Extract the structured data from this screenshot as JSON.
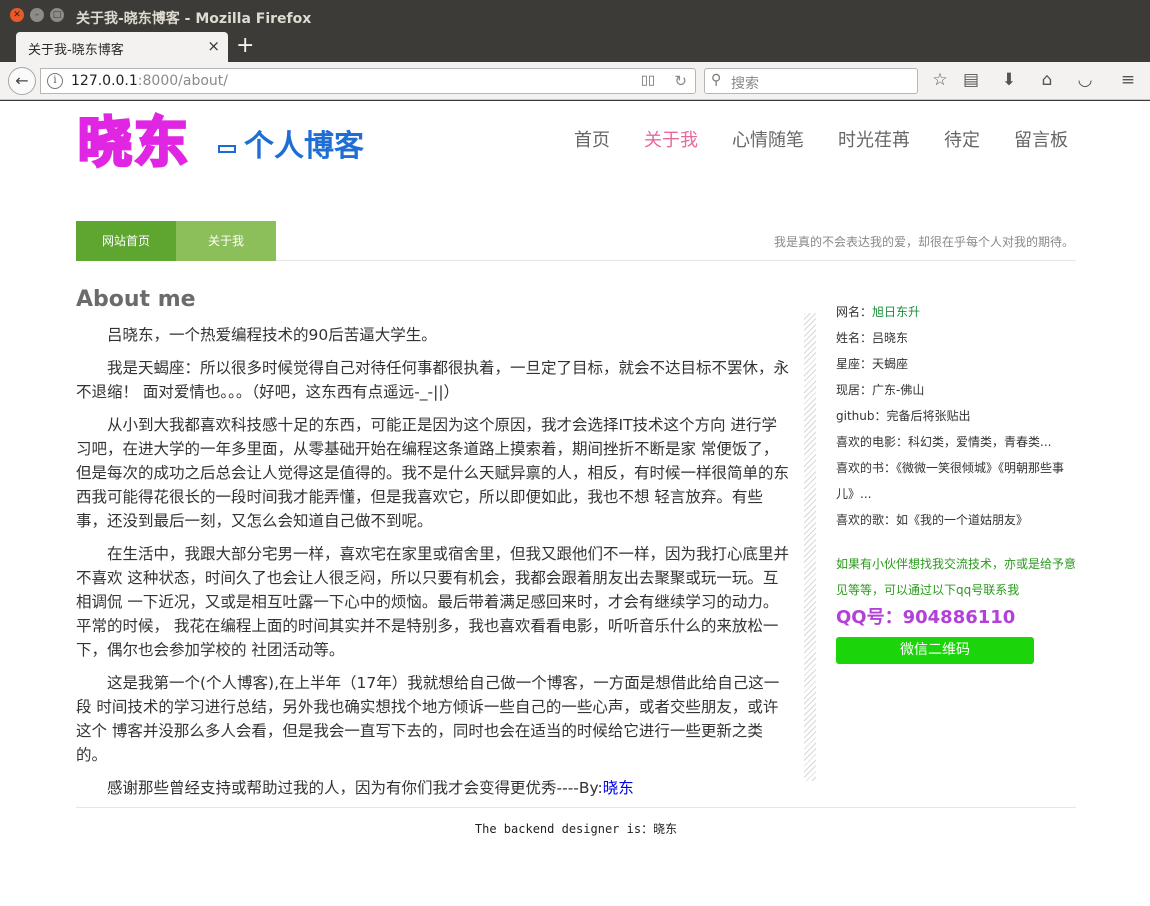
{
  "window": {
    "title": "关于我-晓东博客 - Mozilla Firefox"
  },
  "tab": {
    "title": "关于我-晓东博客",
    "close": "×",
    "new_tab": "+"
  },
  "toolbar": {
    "url_host": "127.0.0.1",
    "url_rest": ":8000/about/",
    "search_placeholder": "搜索"
  },
  "site": {
    "logo_main": "晓东",
    "logo_sub": "个人博客",
    "nav": [
      "首页",
      "关于我",
      "心情随笔",
      "时光荏苒",
      "待定",
      "留言板"
    ],
    "active_nav": "关于我"
  },
  "breadcrumb": {
    "home": "网站首页",
    "current": "关于我",
    "motto": "我是真的不会表达我的爱，却很在乎每个人对我的期待。"
  },
  "article": {
    "heading": "About me",
    "paragraphs": [
      "吕晓东，一个热爱编程技术的90后苦逼大学生。",
      "我是天蝎座：所以很多时候觉得自己对待任何事都很执着，一旦定了目标，就会不达目标不罢休，永不退缩！ 面对爱情也。。。（好吧，这东西有点遥远-_-||）",
      "从小到大我都喜欢科技感十足的东西，可能正是因为这个原因，我才会选择IT技术这个方向 进行学习吧，在进大学的一年多里面，从零基础开始在编程这条道路上摸索着，期间挫折不断是家 常便饭了，但是每次的成功之后总会让人觉得这是值得的。我不是什么天赋异禀的人，相反，有时候一样很简单的东西我可能得花很长的一段时间我才能弄懂，但是我喜欢它，所以即便如此，我也不想 轻言放弃。有些事，还没到最后一刻，又怎么会知道自己做不到呢。",
      "在生活中，我跟大部分宅男一样，喜欢宅在家里或宿舍里，但我又跟他们不一样，因为我打心底里并不喜欢 这种状态，时间久了也会让人很乏闷，所以只要有机会，我都会跟着朋友出去聚聚或玩一玩。互相调侃 一下近况，又或是相互吐露一下心中的烦恼。最后带着满足感回来时，才会有继续学习的动力。平常的时候， 我花在编程上面的时间其实并不是特别多，我也喜欢看看电影，听听音乐什么的来放松一下，偶尔也会参加学校的 社团活动等。",
      "这是我第一个(个人博客),在上半年（17年）我就想给自己做一个博客，一方面是想借此给自己这一段 时间技术的学习进行总结，另外我也确实想找个地方倾诉一些自己的一些心声，或者交些朋友，或许这个 博客并没那么多人会看，但是我会一直写下去的，同时也会在适当的时候给它进行一些更新之类的。"
    ],
    "closing": "感谢那些曾经支持或帮助过我的人，因为有你们我才会变得更优秀----By:",
    "author": "晓东"
  },
  "sidebar": {
    "netname_label": "网名：",
    "netname": "旭日东升",
    "lines": [
      "姓名：吕晓东",
      "星座：天蝎座",
      "现居：广东-佛山",
      "github：完备后将张贴出",
      "喜欢的电影：科幻类，爱情类，青春类...",
      "喜欢的书：《微微一笑很倾城》《明朝那些事儿》...",
      "喜欢的歌：如《我的一个道姑朋友》"
    ],
    "contact": "如果有小伙伴想找我交流技术，亦或是给予意见等等，可以通过以下qq号联系我",
    "qq": "QQ号：904886110",
    "wechat_button": "微信二维码"
  },
  "footer": {
    "text": "The backend designer is：晓东"
  }
}
